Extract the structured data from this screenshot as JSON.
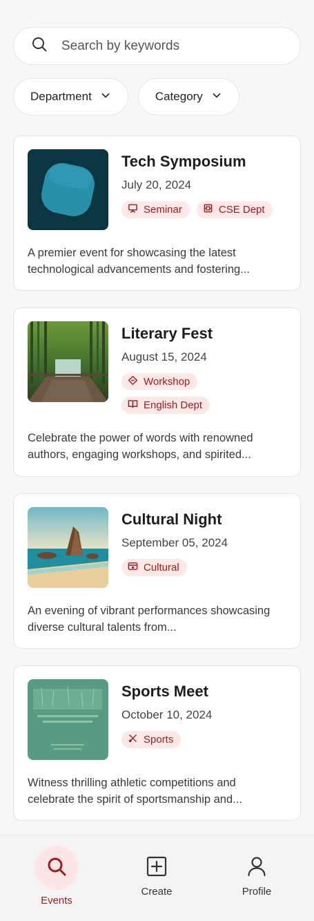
{
  "search": {
    "placeholder": "Search by keywords",
    "icon": "search-icon"
  },
  "filters": [
    {
      "label": "Department",
      "icon": "chevron-down-icon"
    },
    {
      "label": "Category",
      "icon": "chevron-down-icon"
    }
  ],
  "events": [
    {
      "title": "Tech Symposium",
      "date": "July 20, 2024",
      "tags": [
        {
          "label": "Seminar",
          "icon": "presentation-icon"
        },
        {
          "label": "CSE Dept",
          "icon": "cpu-icon"
        }
      ],
      "description": "A premier event for showcasing the latest technological advancements and fostering..."
    },
    {
      "title": "Literary Fest",
      "date": "August 15, 2024",
      "tags": [
        {
          "label": "Workshop",
          "icon": "tool-icon"
        },
        {
          "label": "English Dept",
          "icon": "book-open-icon"
        }
      ],
      "description": "Celebrate the power of words with renowned authors, engaging workshops, and spirited..."
    },
    {
      "title": "Cultural Night",
      "date": "September 05, 2024",
      "tags": [
        {
          "label": "Cultural",
          "icon": "ticket-icon"
        }
      ],
      "description": "An evening of vibrant performances showcasing diverse cultural talents from..."
    },
    {
      "title": "Sports Meet",
      "date": "October 10, 2024",
      "tags": [
        {
          "label": "Sports",
          "icon": "racket-icon"
        }
      ],
      "description": "Witness thrilling athletic competitions and celebrate the spirit of sportsmanship and..."
    }
  ],
  "nav": [
    {
      "label": "Events",
      "icon": "search-icon",
      "active": true
    },
    {
      "label": "Create",
      "icon": "plus-square-icon",
      "active": false
    },
    {
      "label": "Profile",
      "icon": "user-icon",
      "active": false
    }
  ],
  "colors": {
    "accent": "#9b1c1c",
    "tag_bg": "#fde8e8",
    "background": "#f8f8f8"
  }
}
